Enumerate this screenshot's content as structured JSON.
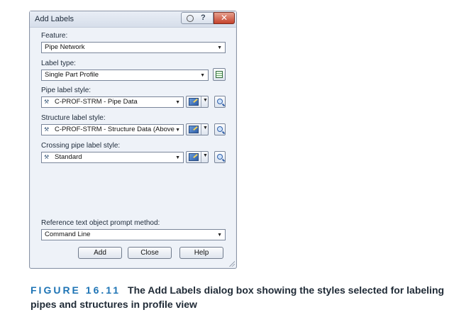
{
  "dialog": {
    "title": "Add Labels",
    "help_glyph": "?",
    "close_glyph": "✕",
    "feature": {
      "label": "Feature:",
      "value": "Pipe Network"
    },
    "label_type": {
      "label": "Label type:",
      "value": "Single Part Profile"
    },
    "pipe_label_style": {
      "label": "Pipe label style:",
      "value": "C-PROF-STRM - Pipe Data"
    },
    "structure_label_style": {
      "label": "Structure label style:",
      "value": "C-PROF-STRM - Structure Data (Above"
    },
    "crossing_pipe_label_style": {
      "label": "Crossing pipe label style:",
      "value": "Standard"
    },
    "reference_prompt": {
      "label": "Reference text object prompt method:",
      "value": "Command Line"
    },
    "buttons": {
      "add": "Add",
      "close": "Close",
      "help": "Help"
    }
  },
  "caption": {
    "figure": "FIGURE 16.11",
    "text": "The Add Labels dialog box showing the styles selected for labeling pipes and structures in profile view"
  },
  "icons": {
    "dropdown": "▼",
    "style": "style-tool-icon"
  },
  "colors": {
    "accent": "#1e74b5",
    "close_button": "#c5422b",
    "dialog_bg": "#eef2f8"
  }
}
